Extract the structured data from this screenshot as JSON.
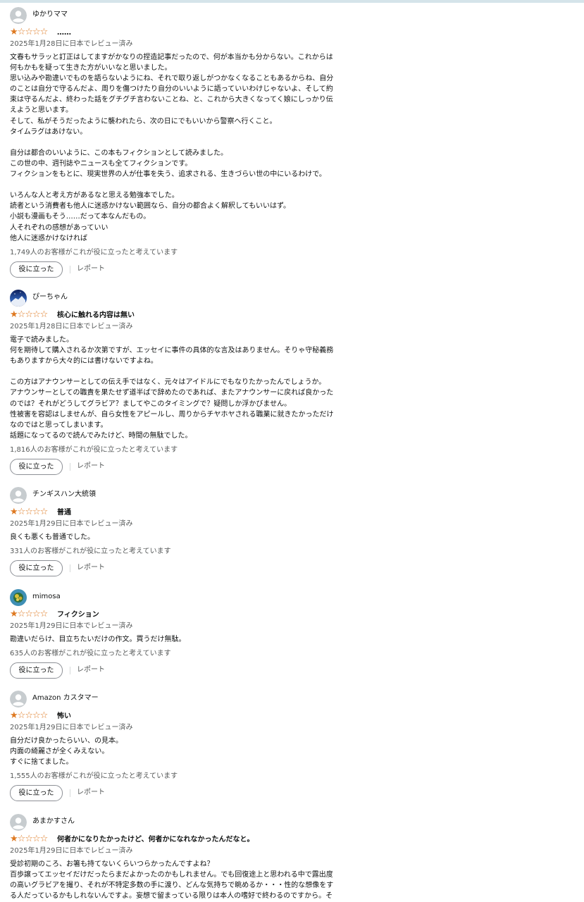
{
  "helpful_button_label": "役に立った",
  "report_label": "レポート",
  "reviews": [
    {
      "name": "ゆかりママ",
      "avatar": "default-user-icon",
      "title": "……",
      "date": "2025年1月28日に日本でレビュー済み",
      "body": [
        "文春もサラッと訂正はしてますがかなりの捏造記事だったので、何が本当かも分からない。これからは",
        "何もかもを疑って生きた方がいいなと思いました。",
        "思い込みや勘違いでものを語らないようにね、それで取り返しがつかなくなることもあるからね、自分",
        "のことは自分で守るんだよ、周りを傷つけたり自分のいいように語っていいわけじゃないよ、そして約",
        "束は守るんだよ、終わった話をグチグチ言わないことね、と、これから大きくなってく娘にしっかり伝",
        "えようと思います。",
        "そして、私がそうだったように襲われたら、次の日にでもいいから警察へ行くこと。",
        "タイムラグはあけない。",
        "",
        "自分は都合のいいように、この本もフィクションとして読みました。",
        "この世の中、週刊誌やニュースも全てフィクションです。",
        "フィクションをもとに、現実世界の人が仕事を失う、追求される、生きづらい世の中にいるわけで。",
        "",
        "いろんな人と考え方があるなと思える勉強本でした。",
        "読者という消費者も他人に迷惑かけない範囲なら、自分の都合よく解釈してもいいはず。",
        "小説も漫画もそう……だって本なんだもの。",
        "人それぞれの感想があっていい",
        "他人に迷惑かけなければ"
      ],
      "helpful": "1,749人のお客様がこれが役に立ったと考えています",
      "rating": 1
    },
    {
      "name": "ぴーちゃん",
      "avatar": "night-sky-photo-avatar",
      "title": "核心に触れる内容は無い",
      "date": "2025年1月28日に日本でレビュー済み",
      "body": [
        "電子で読みました。",
        "何を期待して購入されるか次第ですが、エッセイに事件の具体的な言及はありません。そりゃ守秘義務",
        "もありますから大々的には書けないですよね。",
        "",
        "この方はアナウンサーとしての伝え手ではなく、元々はアイドルにでもなりたかったんでしょうか。",
        "アナウンサーとしての職責を果たせず道半ばで辞めたのであれば、またアナウンサーに戻れば良かった",
        "のでは？それがどうしてグラビア？ましてやこのタイミングで？疑問しか浮かびません。",
        "性被害を容認はしませんが、自ら女性をアピールし、周りからチヤホヤされる職業に就きたかっただけ",
        "なのではと思ってしまいます。",
        "話題になってるので読んでみたけど、時間の無駄でした。"
      ],
      "helpful": "1,816人のお客様がこれが役に立ったと考えています",
      "rating": 1
    },
    {
      "name": "チンギスハン大統領",
      "avatar": "default-user-icon",
      "title": "普通",
      "date": "2025年1月29日に日本でレビュー済み",
      "body": [
        "良くも悪くも普通でした。"
      ],
      "helpful": "331人のお客様がこれが役に立ったと考えています",
      "rating": 1
    },
    {
      "name": "mimosa",
      "avatar": "flower-photo-avatar",
      "title": "フィクション",
      "date": "2025年1月29日に日本でレビュー済み",
      "body": [
        "勘違いだらけ、目立ちたいだけの作文。買うだけ無駄。"
      ],
      "helpful": "635人のお客様がこれが役に立ったと考えています",
      "rating": 1
    },
    {
      "name": "Amazon カスタマー",
      "avatar": "default-user-icon",
      "title": "怖い",
      "date": "2025年1月29日に日本でレビュー済み",
      "body": [
        "自分だけ良かったらいい、の見本。",
        "内面の綺麗さが全くみえない。",
        "すぐに捨てました。"
      ],
      "helpful": "1,555人のお客様がこれが役に立ったと考えています",
      "rating": 1
    },
    {
      "name": "あまかすさん",
      "avatar": "default-user-icon",
      "title": "何者かになりたかったけど、何者かになれなかったんだなと。",
      "date": "2025年1月29日に日本でレビュー済み",
      "body": [
        "受診初期のころ、お箸も持てないくらいつらかったんですよね？",
        "百歩譲ってエッセイだけだったらまだよかったのかもしれません。でも回復途上と思われる中で露出度",
        "の高いグラビアを撮り、それが不特定多数の手に渡り、どんな気持ちで眺めるか・・・性的な想像をす",
        "る人だっているかもしれないんですよ。妄想で留まっている限りは本人の嗜好で終わるのですから。そ"
      ],
      "rating": 1
    }
  ]
}
